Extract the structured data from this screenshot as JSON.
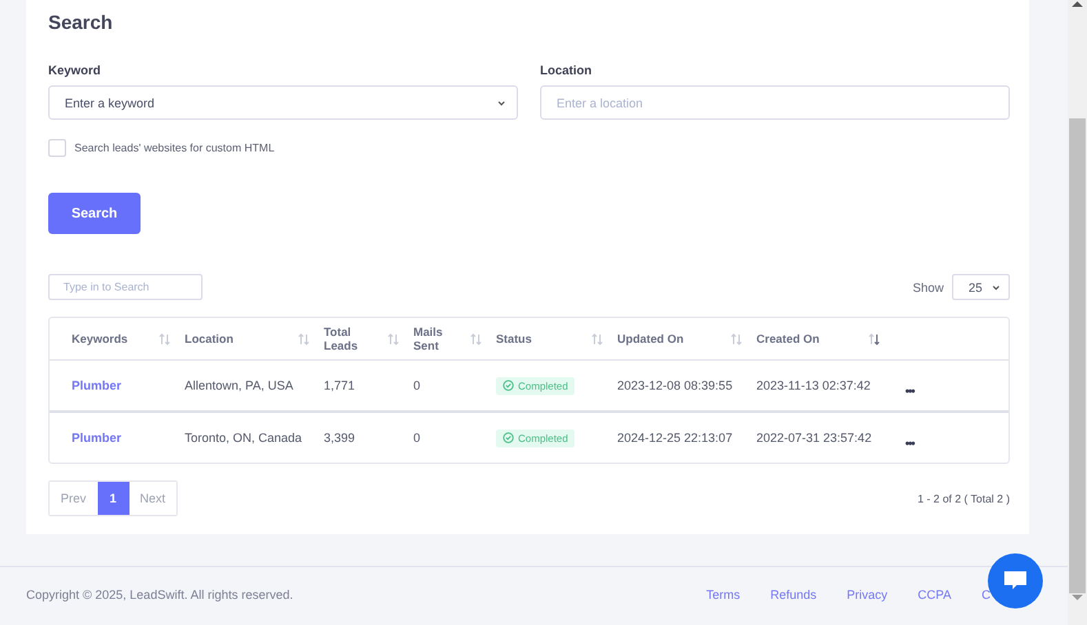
{
  "search_panel": {
    "title": "Search",
    "keyword": {
      "label": "Keyword",
      "placeholder": "Enter a keyword"
    },
    "location": {
      "label": "Location",
      "placeholder": "Enter a location"
    },
    "custom_html": {
      "label": "Search leads' websites for custom HTML",
      "checked": false
    },
    "button": "Search"
  },
  "table_tools": {
    "filter_placeholder": "Type in to Search",
    "show_label": "Show",
    "page_size": "25"
  },
  "table": {
    "columns": [
      {
        "label": "Keywords",
        "sorted": false
      },
      {
        "label": "Location",
        "sorted": false
      },
      {
        "label": "Total Leads",
        "sorted": false
      },
      {
        "label": "Mails Sent",
        "sorted": false
      },
      {
        "label": "Status",
        "sorted": false
      },
      {
        "label": "Updated On",
        "sorted": false
      },
      {
        "label": "Created On",
        "sorted": true
      }
    ],
    "rows": [
      {
        "keyword": "Plumber",
        "location": "Allentown, PA, USA",
        "total_leads": "1,771",
        "mails_sent": "0",
        "status": "Completed",
        "updated_on": "2023-12-08 08:39:55",
        "created_on": "2023-11-13 02:37:42",
        "actions": "•••"
      },
      {
        "keyword": "Plumber",
        "location": "Toronto, ON, Canada",
        "total_leads": "3,399",
        "mails_sent": "0",
        "status": "Completed",
        "updated_on": "2024-12-25 22:13:07",
        "created_on": "2022-07-31 23:57:42",
        "actions": "•••"
      }
    ]
  },
  "pagination": {
    "prev": "Prev",
    "pages": [
      {
        "label": "1",
        "selected": true
      }
    ],
    "next": "Next",
    "summary": "1 - 2 of 2 ( Total 2 )"
  },
  "footer": {
    "copyright": "Copyright © 2025, LeadSwift. All rights reserved.",
    "links": [
      "Terms",
      "Refunds",
      "Privacy",
      "CCPA",
      "C"
    ]
  }
}
